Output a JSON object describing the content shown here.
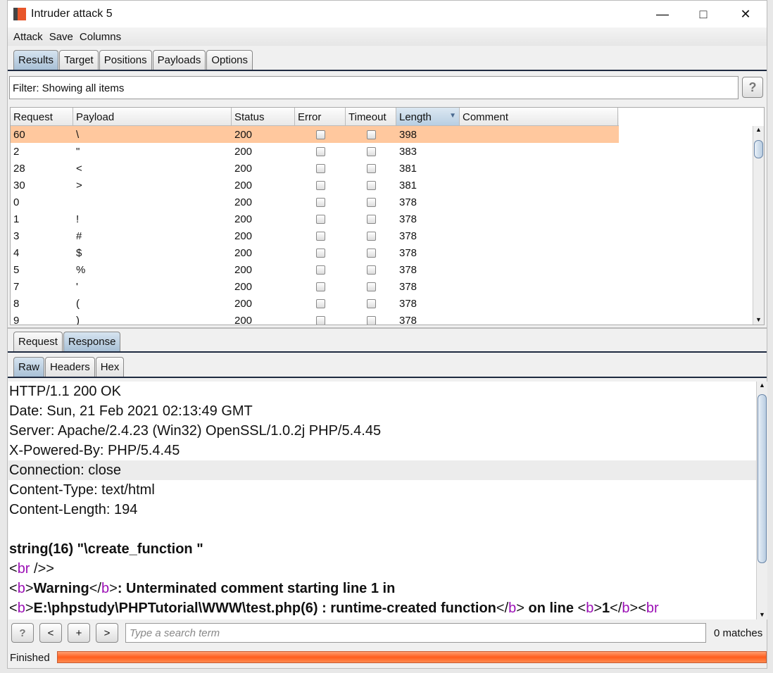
{
  "window": {
    "title": "Intruder attack 5"
  },
  "menu": [
    "Attack",
    "Save",
    "Columns"
  ],
  "tabs": [
    "Results",
    "Target",
    "Positions",
    "Payloads",
    "Options"
  ],
  "filter": "Filter: Showing all items",
  "table": {
    "columns": [
      "Request",
      "Payload",
      "Status",
      "Error",
      "Timeout",
      "Length",
      "Comment"
    ],
    "rows": [
      [
        "60",
        "\\",
        "200",
        "398"
      ],
      [
        "2",
        "\"",
        "200",
        "383"
      ],
      [
        "28",
        "<",
        "200",
        "381"
      ],
      [
        "30",
        ">",
        "200",
        "381"
      ],
      [
        "0",
        "",
        "200",
        "378"
      ],
      [
        "1",
        "!",
        "200",
        "378"
      ],
      [
        "3",
        "#",
        "200",
        "378"
      ],
      [
        "4",
        "$",
        "200",
        "378"
      ],
      [
        "5",
        "%",
        "200",
        "378"
      ],
      [
        "7",
        "'",
        "200",
        "378"
      ],
      [
        "8",
        "(",
        "200",
        "378"
      ],
      [
        "9",
        ")",
        "200",
        "378"
      ]
    ]
  },
  "subtabs": [
    "Request",
    "Response"
  ],
  "viewtabs": [
    "Raw",
    "Headers",
    "Hex"
  ],
  "response": {
    "headers": [
      "HTTP/1.1 200 OK",
      "Date: Sun, 21 Feb 2021 02:13:49 GMT",
      "Server: Apache/2.4.23 (Win32) OpenSSL/1.0.2j PHP/5.4.45",
      "X-Powered-By: PHP/5.4.45",
      "Connection: close",
      "Content-Type: text/html",
      "Content-Length: 194"
    ],
    "body1": "string(16)  \"\\create_function \"",
    "br": "br",
    "br_close": " />",
    "warning": "Warning",
    "warning_rest": ":  Unterminated comment starting line 1 in",
    "path": "E:\\phpstudy\\PHPTutorial\\WWW\\test.php(6) : runtime-created function",
    "online": " on line ",
    "one": "1"
  },
  "search": {
    "placeholder": "Type a search term",
    "matches": "0 matches",
    "buttons": [
      "?",
      "<",
      "+",
      ">"
    ]
  },
  "status": {
    "text": "Finished",
    "progress": 100,
    "color": "#ff6a2a"
  },
  "highlight_color": "#ffc89e"
}
